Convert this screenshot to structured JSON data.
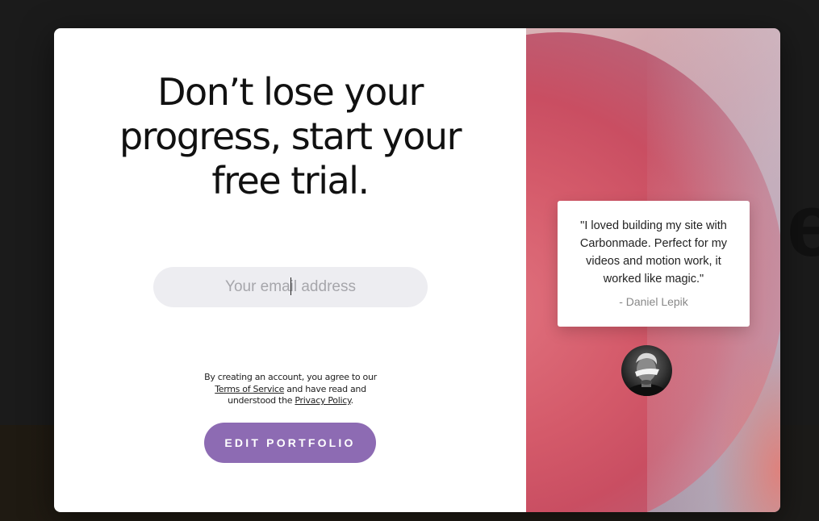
{
  "modal": {
    "headline": "Don’t lose your progress, start your free trial.",
    "email": {
      "placeholder": "Your email address",
      "value": ""
    },
    "legal": {
      "prefix": "By creating an account, you agree to our",
      "terms_link": "Terms of Service",
      "middle": "and have read and understood the",
      "privacy_link": "Privacy Policy",
      "suffix": "."
    },
    "cta_label": "EDIT PORTFOLIO"
  },
  "testimonial": {
    "quote": "\"I loved building my site with Carbonmade. Perfect for my videos and motion work, it worked like magic.\"",
    "author": "- Daniel Lepik"
  },
  "colors": {
    "accent": "#8d6bb3",
    "input_bg": "#ededf1",
    "backdrop": "#1b1b1b"
  },
  "icons": {
    "avatar": "person-photo"
  }
}
